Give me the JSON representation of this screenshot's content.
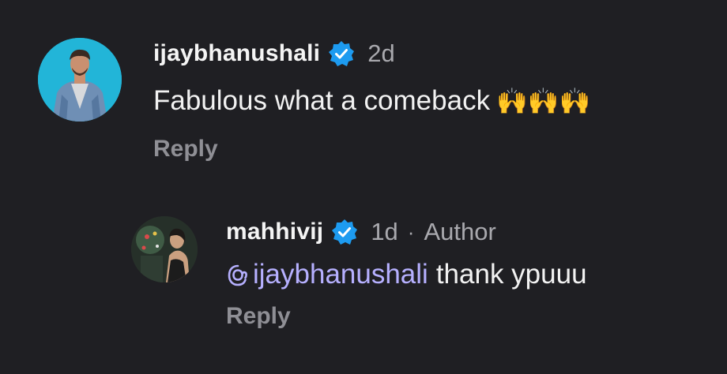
{
  "comments": [
    {
      "username": "ijaybhanushali",
      "time": "2d",
      "text": "Fabulous what a comeback",
      "emoji": "🙌🙌🙌",
      "reply_label": "Reply",
      "verified": true,
      "avatar_bg": "#24b3d6"
    },
    {
      "username": "mahhivij",
      "time": "1d",
      "separator": "·",
      "author_label": "Author",
      "mention": "ijaybhanushali",
      "text": "thank ypuuu",
      "reply_label": "Reply",
      "verified": true,
      "avatar_bg": "#2b2e2d"
    }
  ],
  "colors": {
    "background": "#1f1f23",
    "verified_badge": "#1d9bf0",
    "mention": "#b6b0ff",
    "muted": "#a9a9ae"
  }
}
